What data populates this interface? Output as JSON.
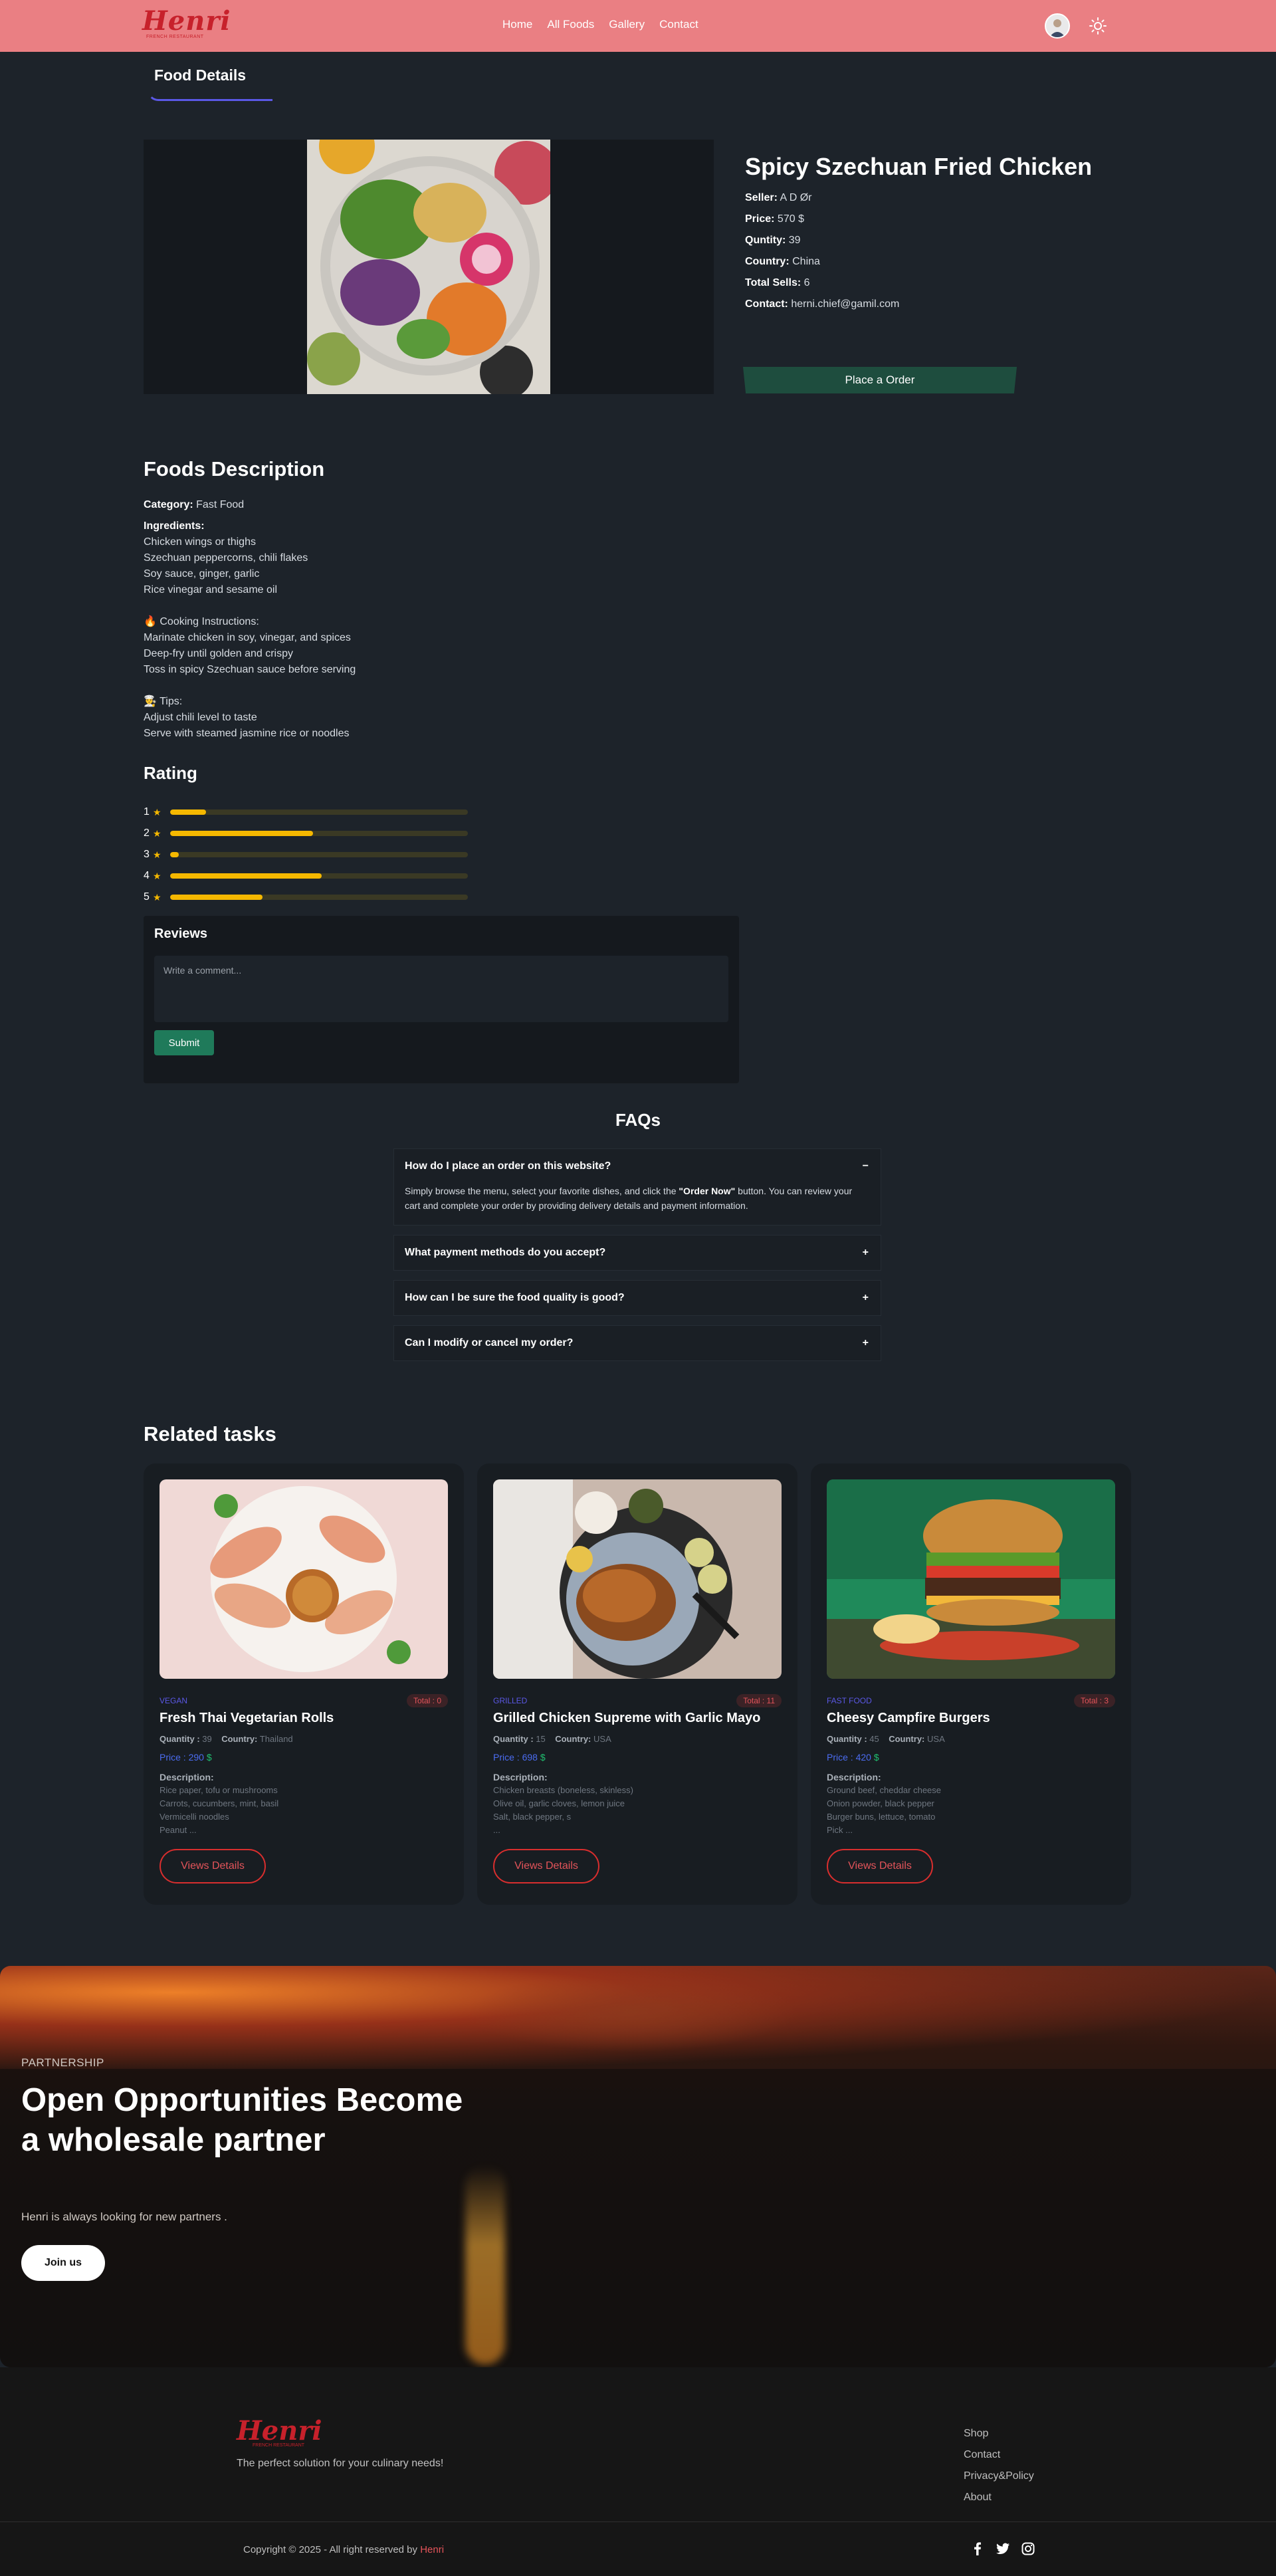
{
  "nav": {
    "logo": "Henri",
    "logo_sub": "FRENCH RESTAURANT",
    "links": [
      "Home",
      "All Foods",
      "Gallery",
      "Contact"
    ]
  },
  "section_title": "Food Details",
  "food": {
    "name": "Spicy Szechuan Fried Chicken",
    "seller_label": "Seller:",
    "seller": "A D Ør",
    "price_label": "Price:",
    "price": "570 $",
    "quantity_label": "Quntity:",
    "quantity": "39",
    "country_label": "Country:",
    "country": "China",
    "sells_label": "Total Sells:",
    "sells": "6",
    "contact_label": "Contact:",
    "contact": "herni.chief@gamil.com",
    "order_button": "Place a Order"
  },
  "description": {
    "title": "Foods Description",
    "category_label": "Category:",
    "category": "Fast Food",
    "ingredients_label": "Ingredients:",
    "ingredients": [
      "Chicken wings or thighs",
      "Szechuan peppercorns, chili flakes",
      "Soy sauce, ginger, garlic",
      "Rice vinegar and sesame oil"
    ],
    "cooking_label": "🔥 Cooking Instructions:",
    "cooking": [
      "Marinate chicken in soy, vinegar, and spices",
      "Deep-fry until golden and crispy",
      "Toss in spicy Szechuan sauce before serving"
    ],
    "tips_label": "👨‍🍳 Tips:",
    "tips": [
      "Adjust chili level to taste",
      "Serve with steamed jasmine rice or noodles"
    ]
  },
  "rating": {
    "title": "Rating",
    "rows": [
      {
        "label": "1",
        "fraction": 0.12
      },
      {
        "label": "2",
        "fraction": 0.48
      },
      {
        "label": "3",
        "fraction": 0.03
      },
      {
        "label": "4",
        "fraction": 0.51
      },
      {
        "label": "5",
        "fraction": 0.31
      }
    ]
  },
  "reviews": {
    "title": "Reviews",
    "placeholder": "Write a comment...",
    "submit": "Submit"
  },
  "faq": {
    "title": "FAQs",
    "items": [
      {
        "q": "How do I place an order on this website?",
        "a_pre": "Simply browse the menu, select your favorite dishes, and click the ",
        "a_bold": "\"Order Now\"",
        "a_post": " button. You can review your cart and complete your order by providing delivery details and payment information.",
        "toggle": "−"
      },
      {
        "q": "What payment methods do you accept?",
        "toggle": "+"
      },
      {
        "q": "How can I be sure the food quality is good?",
        "toggle": "+"
      },
      {
        "q": "Can I modify or cancel my order?",
        "toggle": "+"
      }
    ]
  },
  "related": {
    "title": "Related tasks",
    "cards": [
      {
        "category": "VEGAN",
        "total": "Total : 0",
        "name": "Fresh Thai Vegetarian Rolls",
        "quantity_label": "Quantity :",
        "quantity": "39",
        "country_label": "Country:",
        "country": "Thailand",
        "price": "Price : 290",
        "desc_label": "Description:",
        "desc": [
          "Rice paper, tofu or mushrooms",
          "Carrots, cucumbers, mint, basil",
          "Vermicelli noodles",
          "Peanut ..."
        ],
        "button": "Views Details"
      },
      {
        "category": "GRILLED",
        "total": "Total : 11",
        "name": "Grilled Chicken Supreme with Garlic Mayo",
        "quantity_label": "Quantity :",
        "quantity": "15",
        "country_label": "Country:",
        "country": "USA",
        "price": "Price : 698",
        "desc_label": "Description:",
        "desc": [
          "Chicken breasts (boneless, skinless)",
          "Olive oil, garlic cloves, lemon juice",
          "Salt, black pepper, s",
          "..."
        ],
        "button": "Views Details"
      },
      {
        "category": "FAST FOOD",
        "total": "Total : 3",
        "name": "Cheesy Campfire Burgers",
        "quantity_label": "Quantity :",
        "quantity": "45",
        "country_label": "Country:",
        "country": "USA",
        "price": "Price : 420",
        "desc_label": "Description:",
        "desc": [
          "Ground beef, cheddar cheese",
          "Onion powder, black pepper",
          "Burger buns, lettuce, tomato",
          "Pick ..."
        ],
        "button": "Views Details"
      }
    ],
    "dollar": "$"
  },
  "banner": {
    "kicker": "PARTNERSHIP",
    "heading": "Open Opportunities Become a wholesale partner",
    "sub": "Henri is always looking for new partners .",
    "button": "Join us"
  },
  "footer": {
    "logo": "Henri",
    "logo_sub": "FRENCH RESTAURANT",
    "tagline": "The perfect solution for your culinary needs!",
    "links": [
      "Shop",
      "Contact",
      "Privacy&Policy",
      "About"
    ],
    "copy": "Copyright © 2025 - All right reserved by ",
    "brand": "Henri"
  }
}
